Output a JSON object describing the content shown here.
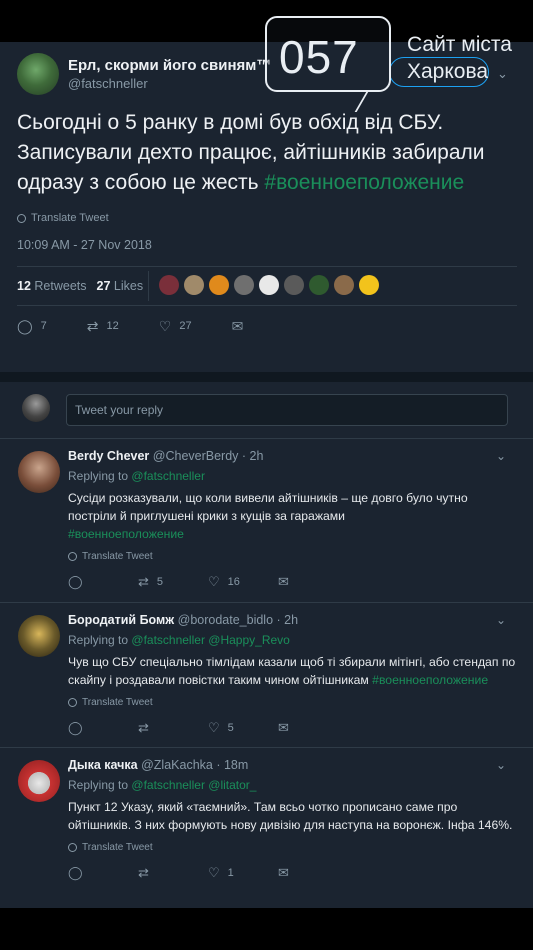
{
  "watermark": {
    "number": "057",
    "line1": "Сайт міста",
    "line2": "Харкова"
  },
  "tweet": {
    "author_name": "Ерл, скорми його свиням™",
    "author_handle": "@fatschneller",
    "text_main": "Сьогодні о 5 ранку в домі був обхід від СБУ. Записували дехто працює, айтішників забирали одразу з собою це жесть ",
    "hashtag": "#военноеположение",
    "translate_label": "Translate Tweet",
    "timestamp": "10:09 AM - 27 Nov 2018",
    "retweets_count": "12",
    "retweets_label": "Retweets",
    "likes_count": "27",
    "likes_label": "Likes",
    "reply_count": "7",
    "retweet_action_count": "12",
    "like_action_count": "27"
  },
  "reply_input": {
    "placeholder": "Tweet your reply"
  },
  "replies": [
    {
      "name": "Berdy Chever",
      "handle": "@CheverBerdy",
      "age": "· 2h",
      "replying_to": "Replying to",
      "mentions": "@fatschneller",
      "text": "Сусіди розказували, що коли вивели айтішників – ще довго було чутно постріли й приглушені крики з кущів за гаражами",
      "hashtag": "#военноеположение",
      "translate": "Translate Tweet",
      "replies": "",
      "retweets": "5",
      "likes": "16"
    },
    {
      "name": "Бородатий Бомж",
      "handle": "@borodate_bidlo",
      "age": "· 2h",
      "replying_to": "Replying to",
      "mentions": "@fatschneller @Happy_Revo",
      "text": "Чув що СБУ спеціально тімлідам казали щоб ті збирали мітінгі, або стендап по скайпу і роздавали повістки таким чином ойтішникам ",
      "hashtag": "#военноеположение",
      "translate": "Translate Tweet",
      "replies": "",
      "retweets": "",
      "likes": "5"
    },
    {
      "name": "Дыка качка",
      "handle": "@ZlaKachka",
      "age": "· 18m",
      "replying_to": "Replying to",
      "mentions": "@fatschneller @litator_",
      "text": "Пункт 12 Указу, який «таємний». Там всьо чотко прописано саме про ойтішників. З них формують нову дивізію для наступа на воронєж. Інфа 146%.",
      "hashtag": "",
      "translate": "Translate Tweet",
      "replies": "",
      "retweets": "",
      "likes": "1"
    }
  ],
  "colors": {
    "background": "#1b2430",
    "hashtag": "#1a8f5a",
    "muted": "#8899a6",
    "text": "#eef1f4"
  },
  "icons": [
    "reply-icon",
    "retweet-icon",
    "heart-icon",
    "message-icon",
    "globe-icon",
    "chevron-down-icon"
  ]
}
